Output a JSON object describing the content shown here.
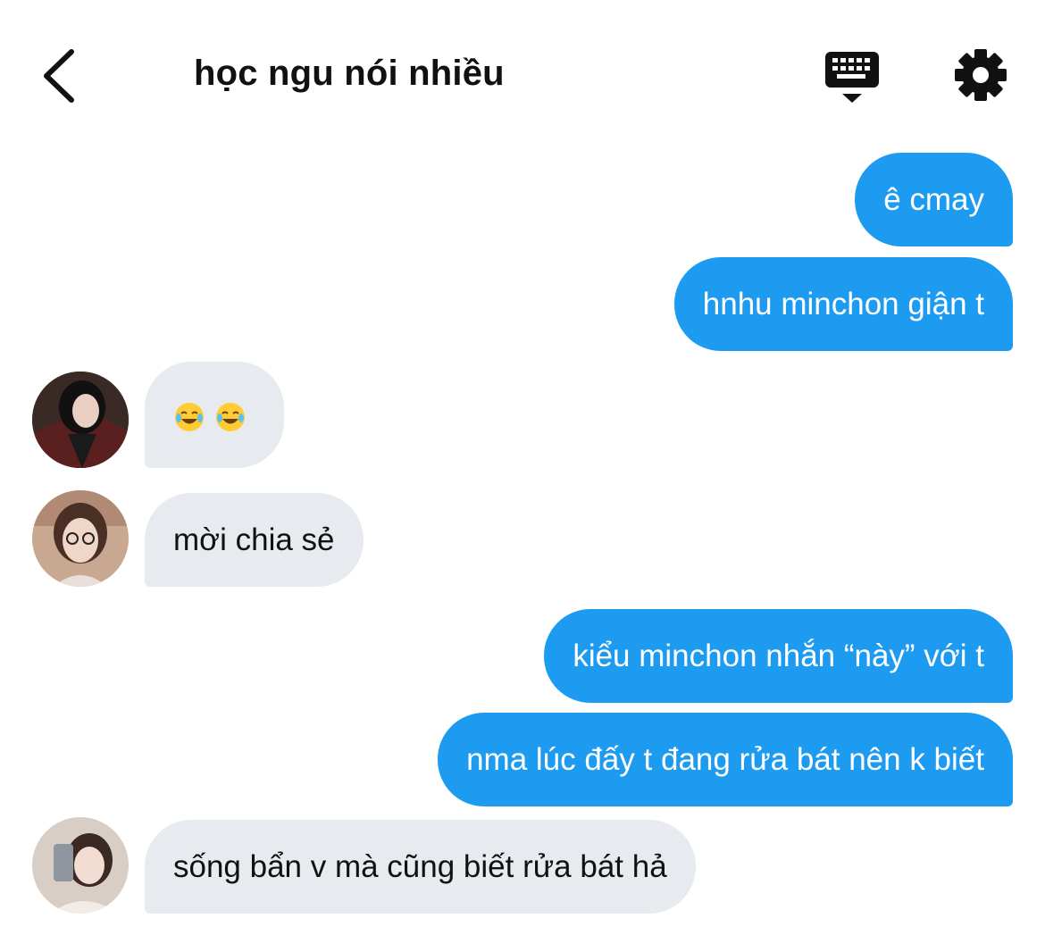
{
  "header": {
    "title": "học ngu nói nhiều",
    "back_icon": "chevron-left-icon",
    "keyboard_icon": "keyboard-icon",
    "settings_icon": "gear-icon"
  },
  "messages": [
    {
      "direction": "outgoing",
      "text": "ê cmay"
    },
    {
      "direction": "outgoing",
      "text": "hnhu minchon giận t"
    },
    {
      "direction": "incoming",
      "text": "😂😂",
      "emoji": "face-with-tears-of-joy"
    },
    {
      "direction": "incoming",
      "text": "mời chia sẻ"
    },
    {
      "direction": "outgoing",
      "text": "kiểu minchon nhắn “này” với t"
    },
    {
      "direction": "outgoing",
      "text": "nma lúc đấy t đang rửa bát nên k biết"
    },
    {
      "direction": "incoming",
      "text": "sống bẩn v mà cũng biết rửa bát hả"
    }
  ],
  "colors": {
    "outgoing_bubble": "#1d9bf0",
    "incoming_bubble": "#e7ebef",
    "text": "#111111"
  }
}
